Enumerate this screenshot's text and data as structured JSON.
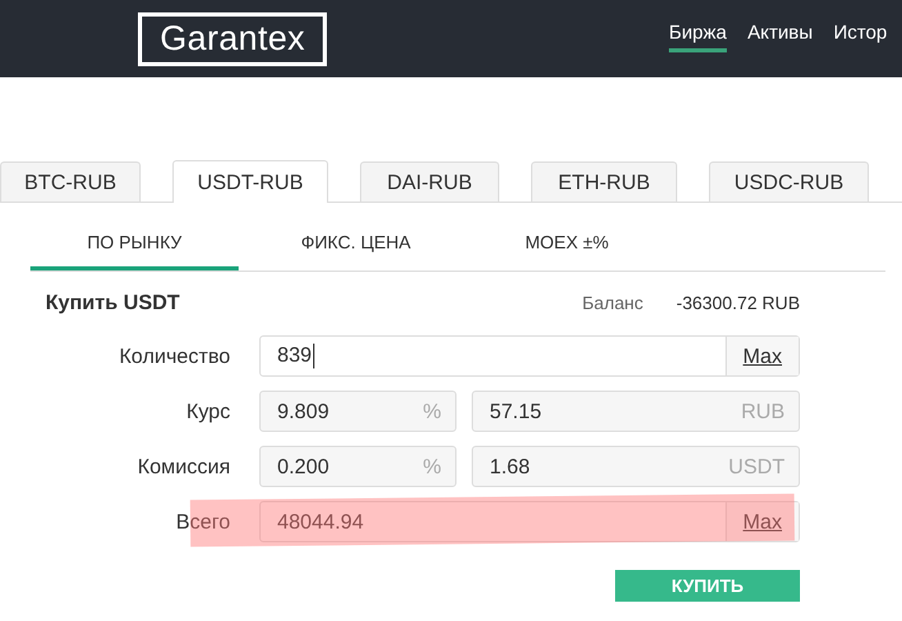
{
  "header": {
    "logo": "Garantex",
    "nav": [
      {
        "label": "Биржа",
        "selected": true
      },
      {
        "label": "Активы",
        "selected": false
      },
      {
        "label": "Истор",
        "selected": false
      }
    ]
  },
  "market_tabs": [
    {
      "label": "BTC-RUB",
      "selected": false
    },
    {
      "label": "USDT-RUB",
      "selected": true
    },
    {
      "label": "DAI-RUB",
      "selected": false
    },
    {
      "label": "ETH-RUB",
      "selected": false
    },
    {
      "label": "USDC-RUB",
      "selected": false
    }
  ],
  "order_tabs": [
    {
      "label": "ПО РЫНКУ",
      "selected": true
    },
    {
      "label": "ФИКС. ЦЕНА",
      "selected": false
    },
    {
      "label": "MOEX ±%",
      "selected": false
    }
  ],
  "form": {
    "title": "Купить USDT",
    "balance_label": "Баланс",
    "balance": "-36300.72 RUB",
    "rows": [
      {
        "kind": "single",
        "label": "Количество",
        "value": "839",
        "button": "Max",
        "highlighted": false
      },
      {
        "kind": "split",
        "label": "Курс",
        "value": "9.809",
        "unit": "%",
        "value_2": "57.15",
        "unit_2": "RUB",
        "highlighted": false
      },
      {
        "kind": "split",
        "label": "Комиссия",
        "value": "0.200",
        "unit": "%",
        "value_2": "1.68",
        "unit_2": "USDT",
        "highlighted": false
      },
      {
        "kind": "single",
        "label": "Всего",
        "value": "48044.94",
        "button": "Max",
        "highlighted": true
      }
    ],
    "submit": "КУПИТЬ"
  }
}
